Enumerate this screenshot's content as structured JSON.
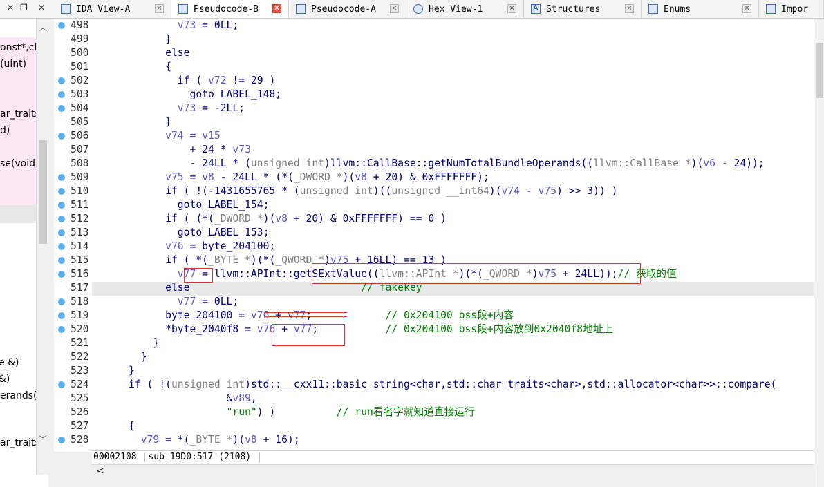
{
  "tabs": [
    {
      "label": "IDA View-A",
      "icon": "ida-view-icon",
      "active": false,
      "close_red": false
    },
    {
      "label": "Pseudocode-B",
      "icon": "pseudocode-icon",
      "active": true,
      "close_red": true
    },
    {
      "label": "Pseudocode-A",
      "icon": "pseudocode-icon",
      "active": false,
      "close_red": false
    },
    {
      "label": "Hex View-1",
      "icon": "hex-view-icon",
      "active": false,
      "close_red": false
    },
    {
      "label": "Structures",
      "icon": "structures-icon",
      "active": false,
      "close_red": false
    },
    {
      "label": "Enums",
      "icon": "enums-icon",
      "active": false,
      "close_red": false
    },
    {
      "label": "Impor",
      "icon": "imports-icon",
      "active": false,
      "close_red": false
    }
  ],
  "window_controls": {
    "close": "✕",
    "restore": "❐"
  },
  "left_panel": {
    "items": [
      "onst*,ch",
      "(uint)",
      "ar_traits",
      "d)",
      "se(void",
      "e &)",
      "&)",
      "erands(v",
      "ar_traits"
    ]
  },
  "code_lines": [
    {
      "n": "498",
      "dot": true,
      "segs": [
        {
          "t": "              "
        },
        {
          "t": "v73",
          "c": "v"
        },
        {
          "t": " = 0LL;"
        }
      ]
    },
    {
      "n": "499",
      "dot": false,
      "segs": [
        {
          "t": "            }"
        }
      ]
    },
    {
      "n": "500",
      "dot": false,
      "segs": [
        {
          "t": "            else"
        }
      ]
    },
    {
      "n": "501",
      "dot": false,
      "segs": [
        {
          "t": "            {"
        }
      ]
    },
    {
      "n": "502",
      "dot": true,
      "segs": [
        {
          "t": "              if ( "
        },
        {
          "t": "v72",
          "c": "v"
        },
        {
          "t": " != 29 )"
        }
      ]
    },
    {
      "n": "503",
      "dot": true,
      "segs": [
        {
          "t": "                goto LABEL_148;"
        }
      ]
    },
    {
      "n": "504",
      "dot": true,
      "segs": [
        {
          "t": "              "
        },
        {
          "t": "v73",
          "c": "v"
        },
        {
          "t": " = -2LL;"
        }
      ]
    },
    {
      "n": "505",
      "dot": false,
      "segs": [
        {
          "t": "            }"
        }
      ]
    },
    {
      "n": "506",
      "dot": true,
      "segs": [
        {
          "t": "            "
        },
        {
          "t": "v74",
          "c": "v"
        },
        {
          "t": " = "
        },
        {
          "t": "v15",
          "c": "v"
        }
      ]
    },
    {
      "n": "507",
      "dot": false,
      "segs": [
        {
          "t": "                + 24 * "
        },
        {
          "t": "v73",
          "c": "v"
        }
      ]
    },
    {
      "n": "508",
      "dot": false,
      "segs": [
        {
          "t": "                - 24LL * ("
        },
        {
          "t": "unsigned int",
          "c": "k"
        },
        {
          "t": ")llvm::CallBase::getNumTotalBundleOperands(("
        },
        {
          "t": "llvm::CallBase *",
          "c": "k"
        },
        {
          "t": ")("
        },
        {
          "t": "v6",
          "c": "v"
        },
        {
          "t": " - 24));"
        }
      ]
    },
    {
      "n": "509",
      "dot": true,
      "segs": [
        {
          "t": "            "
        },
        {
          "t": "v75",
          "c": "v"
        },
        {
          "t": " = "
        },
        {
          "t": "v8",
          "c": "v"
        },
        {
          "t": " - 24LL * (*("
        },
        {
          "t": "_DWORD *",
          "c": "k"
        },
        {
          "t": ")("
        },
        {
          "t": "v8",
          "c": "v"
        },
        {
          "t": " + 20) & 0xFFFFFFF);"
        }
      ]
    },
    {
      "n": "510",
      "dot": true,
      "segs": [
        {
          "t": "            if ( !(-1431655765 * ("
        },
        {
          "t": "unsigned int",
          "c": "k"
        },
        {
          "t": ")(("
        },
        {
          "t": "unsigned __int64",
          "c": "k"
        },
        {
          "t": ")("
        },
        {
          "t": "v74",
          "c": "v"
        },
        {
          "t": " - "
        },
        {
          "t": "v75",
          "c": "v"
        },
        {
          "t": ") >> 3)) )"
        }
      ]
    },
    {
      "n": "511",
      "dot": true,
      "segs": [
        {
          "t": "              goto LABEL_154;"
        }
      ]
    },
    {
      "n": "512",
      "dot": true,
      "segs": [
        {
          "t": "            if ( (*("
        },
        {
          "t": "_DWORD *",
          "c": "k"
        },
        {
          "t": ")("
        },
        {
          "t": "v8",
          "c": "v"
        },
        {
          "t": " + 20) & 0xFFFFFFF) == 0 )"
        }
      ]
    },
    {
      "n": "513",
      "dot": true,
      "segs": [
        {
          "t": "              goto LABEL_153;"
        }
      ]
    },
    {
      "n": "514",
      "dot": true,
      "segs": [
        {
          "t": "            "
        },
        {
          "t": "v76",
          "c": "v"
        },
        {
          "t": " = byte_204100;"
        }
      ]
    },
    {
      "n": "515",
      "dot": true,
      "segs": [
        {
          "t": "            if ( *("
        },
        {
          "t": "_BYTE *",
          "c": "k"
        },
        {
          "t": ")(*("
        },
        {
          "t": "_QWORD *",
          "c": "k"
        },
        {
          "t": ")"
        },
        {
          "t": "v75",
          "c": "v"
        },
        {
          "t": " + 16LL) == 13 )"
        }
      ]
    },
    {
      "n": "516",
      "dot": true,
      "segs": [
        {
          "t": "              "
        },
        {
          "t": "v77",
          "c": "v"
        },
        {
          "t": " = llvm::APInt::getSExtValue(("
        },
        {
          "t": "llvm::APInt *",
          "c": "k"
        },
        {
          "t": ")(*("
        },
        {
          "t": "_QWORD *",
          "c": "k"
        },
        {
          "t": ")"
        },
        {
          "t": "v75",
          "c": "v"
        },
        {
          "t": " + 24LL));"
        },
        {
          "t": "// 获取的值",
          "c": "c"
        }
      ]
    },
    {
      "n": "517",
      "dot": false,
      "segs": [
        {
          "t": "            else                            "
        },
        {
          "t": "// fakekey",
          "c": "c"
        }
      ]
    },
    {
      "n": "518",
      "dot": true,
      "segs": [
        {
          "t": "              "
        },
        {
          "t": "v77",
          "c": "v"
        },
        {
          "t": " = 0LL;"
        }
      ]
    },
    {
      "n": "519",
      "dot": true,
      "segs": [
        {
          "t": "            byte_204100 = "
        },
        {
          "t": "v76",
          "c": "v"
        },
        {
          "t": " + "
        },
        {
          "t": "v77",
          "c": "v"
        },
        {
          "t": ";            "
        },
        {
          "t": "// 0x204100 bss段+内容",
          "c": "c"
        }
      ]
    },
    {
      "n": "520",
      "dot": true,
      "segs": [
        {
          "t": "            *byte_2040f8 = "
        },
        {
          "t": "v76",
          "c": "v"
        },
        {
          "t": " + "
        },
        {
          "t": "v77",
          "c": "v"
        },
        {
          "t": ";           "
        },
        {
          "t": "// 0x204100 bss段+内容放到0x2040f8地址上",
          "c": "c"
        }
      ]
    },
    {
      "n": "521",
      "dot": false,
      "segs": [
        {
          "t": "          }"
        }
      ]
    },
    {
      "n": "522",
      "dot": false,
      "segs": [
        {
          "t": "        }"
        }
      ]
    },
    {
      "n": "523",
      "dot": false,
      "segs": [
        {
          "t": "      }"
        }
      ]
    },
    {
      "n": "524",
      "dot": true,
      "segs": [
        {
          "t": "      if ( !("
        },
        {
          "t": "unsigned int",
          "c": "k"
        },
        {
          "t": ")std::__cxx11::basic_string<char,std::char_traits<char>,std::allocator<char>>::compare("
        }
      ]
    },
    {
      "n": "525",
      "dot": false,
      "segs": [
        {
          "t": "                      &"
        },
        {
          "t": "v89",
          "c": "v"
        },
        {
          "t": ","
        }
      ]
    },
    {
      "n": "526",
      "dot": false,
      "segs": [
        {
          "t": "                      "
        },
        {
          "t": "\"run\"",
          "c": "s"
        },
        {
          "t": ") )          "
        },
        {
          "t": "// run看名字就知道直接运行",
          "c": "c"
        }
      ]
    },
    {
      "n": "527",
      "dot": false,
      "segs": [
        {
          "t": "      {"
        }
      ]
    },
    {
      "n": "528",
      "dot": true,
      "segs": [
        {
          "t": "        "
        },
        {
          "t": "v79",
          "c": "v"
        },
        {
          "t": " = *("
        },
        {
          "t": "_BYTE *",
          "c": "k"
        },
        {
          "t": ")("
        },
        {
          "t": "v8",
          "c": "v"
        },
        {
          "t": " + 16);"
        }
      ]
    }
  ],
  "status": {
    "address": "00002108",
    "location": "sub_19D0:517 (2108)"
  }
}
